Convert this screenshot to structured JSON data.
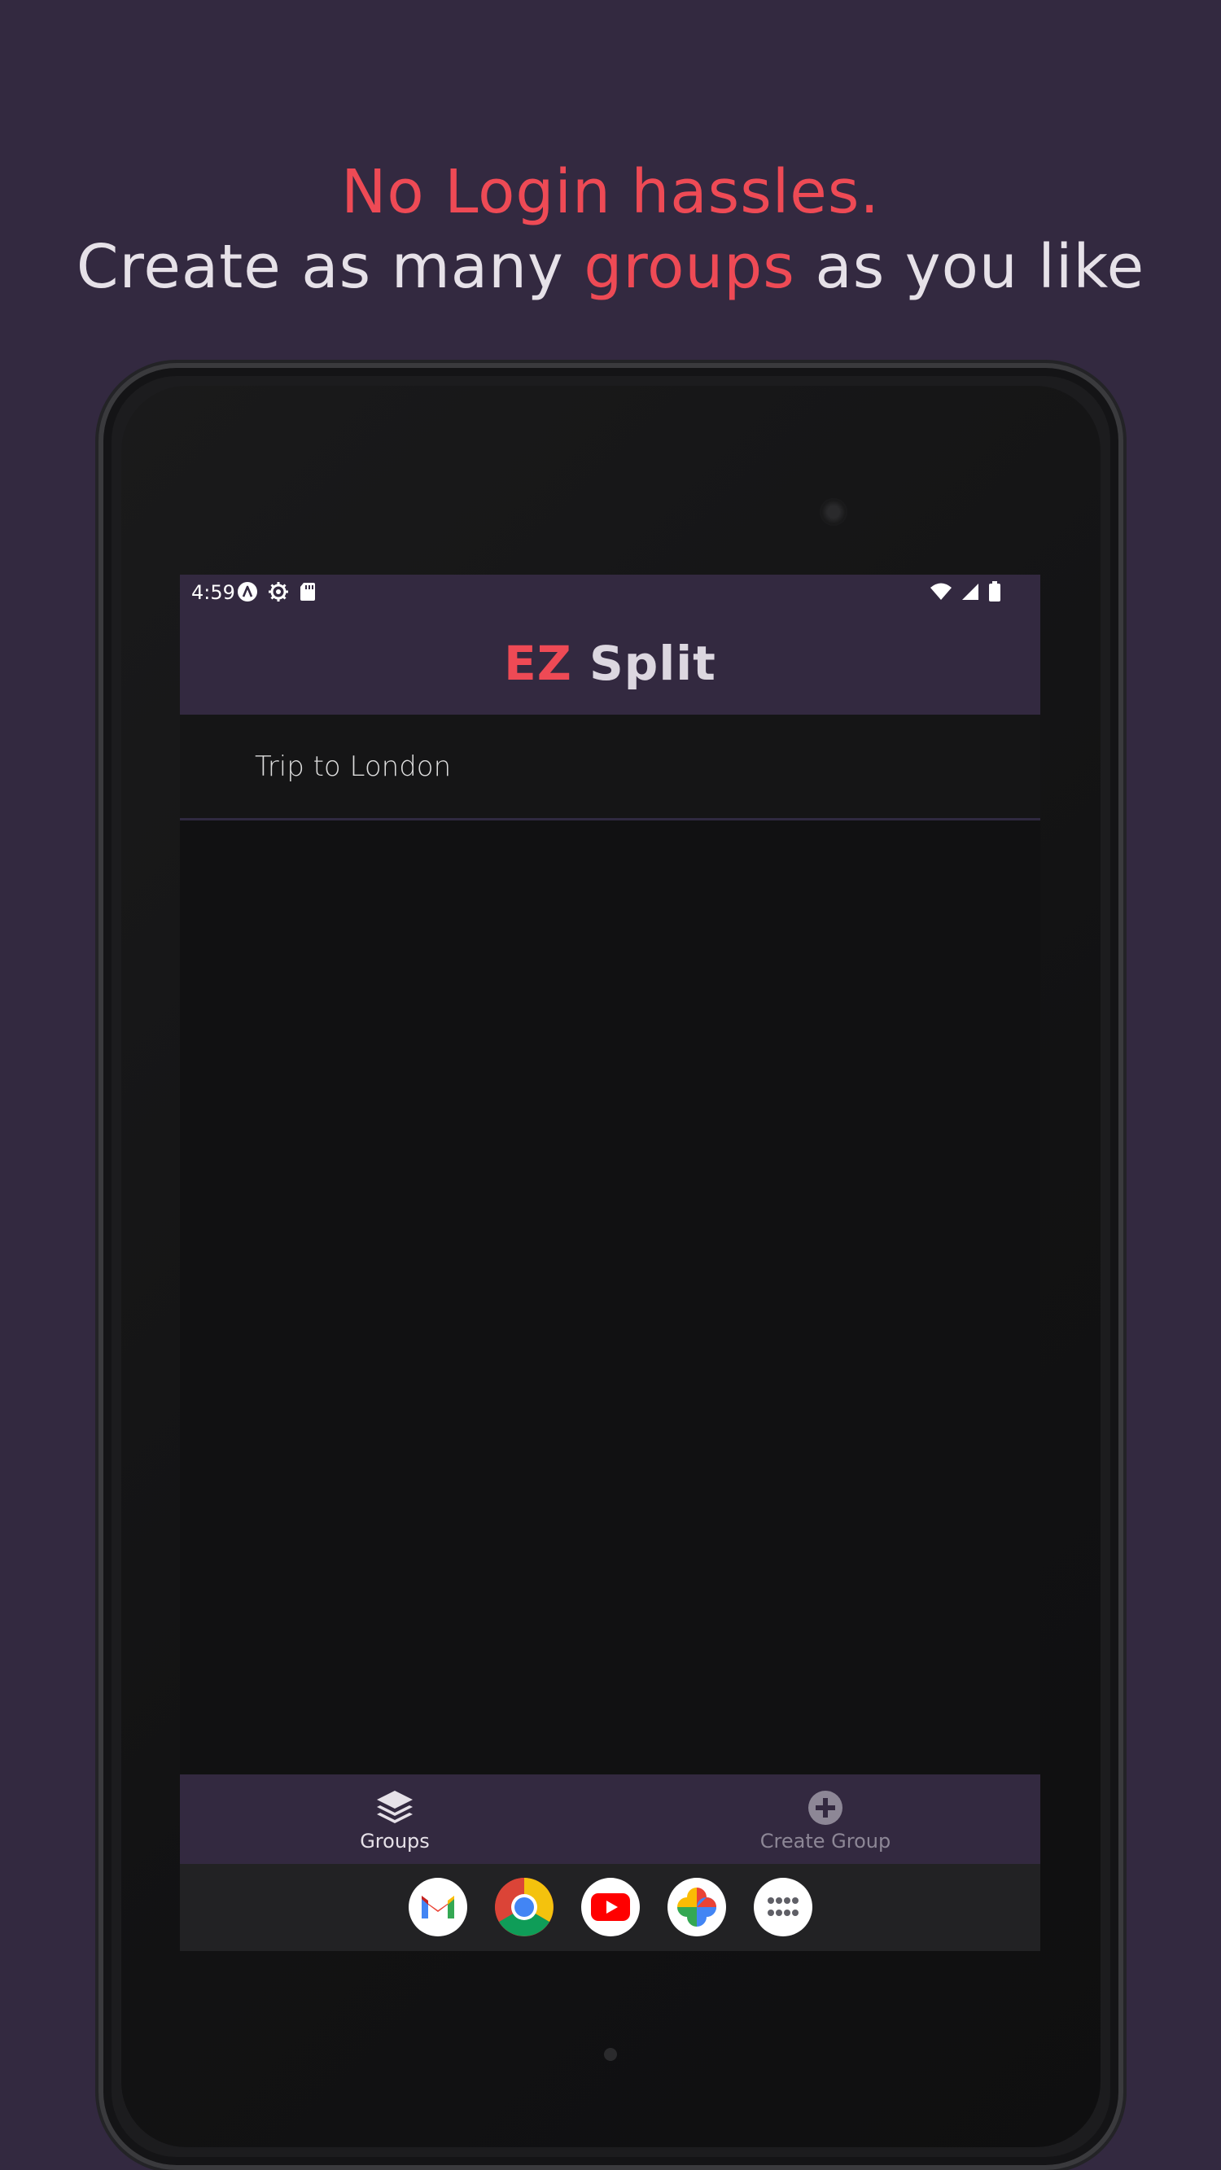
{
  "headline": {
    "line1": "No Login hassles.",
    "line2_prefix": "Create as many ",
    "line2_accent": "groups",
    "line2_suffix": " as you like"
  },
  "status_bar": {
    "time": "4:59"
  },
  "app_bar": {
    "title_accent": "EZ",
    "title_rest": " Split"
  },
  "groups_list": [
    {
      "name": "Trip to London"
    }
  ],
  "bottom_nav": {
    "items": [
      {
        "label": "Groups",
        "icon": "layers-icon",
        "active": true
      },
      {
        "label": "Create Group",
        "icon": "add-circle-icon",
        "active": false
      }
    ]
  },
  "dock": {
    "apps": [
      "gmail-icon",
      "chrome-icon",
      "youtube-icon",
      "photos-icon",
      "app-drawer-icon"
    ]
  },
  "colors": {
    "background": "#332940",
    "accent": "#ee4a55",
    "text_light": "#e6e1e8",
    "screen_bg": "#111112"
  }
}
